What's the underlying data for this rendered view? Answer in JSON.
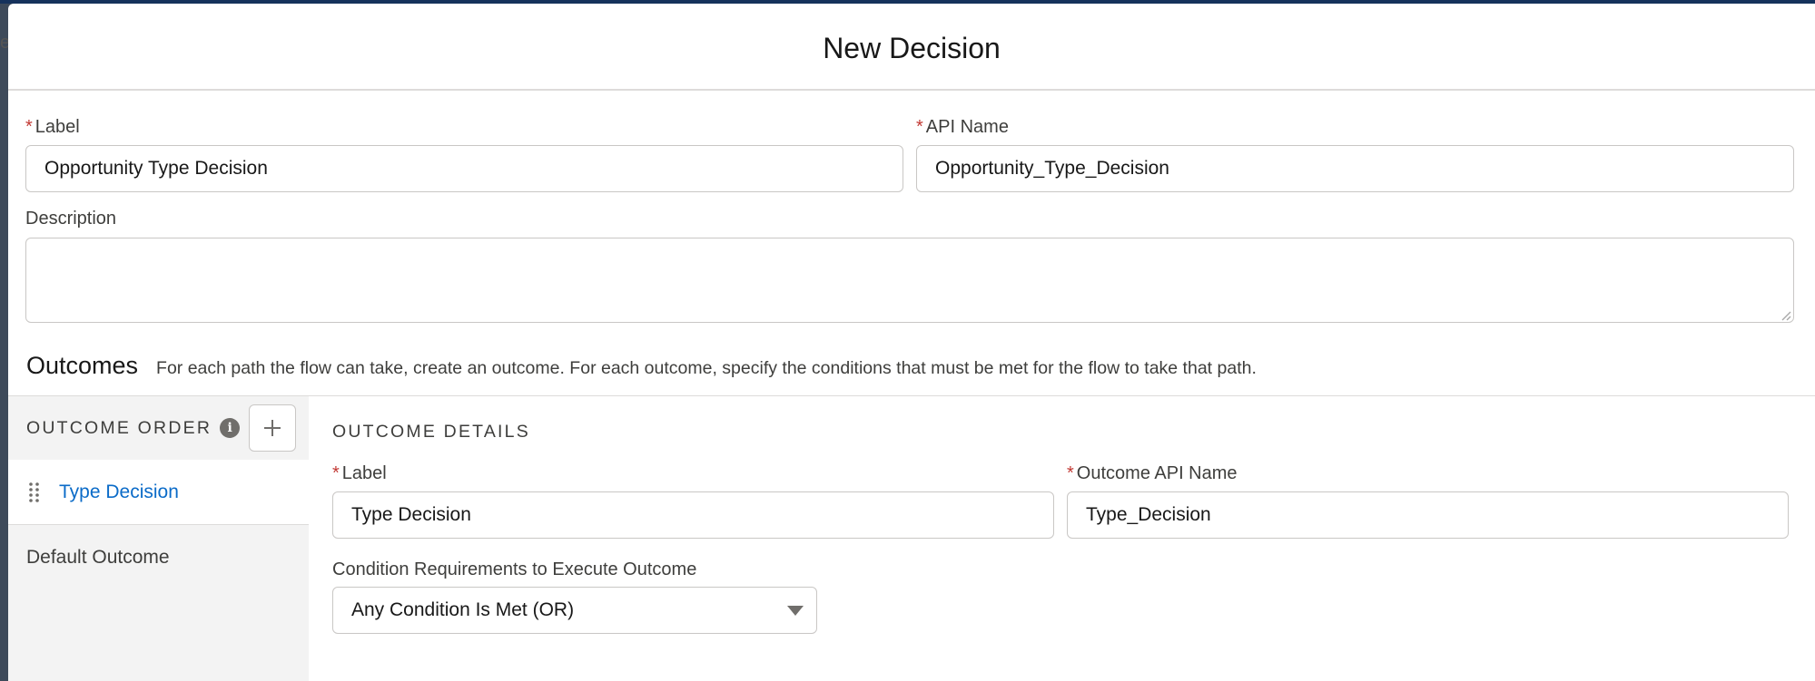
{
  "modal": {
    "title": "New Decision"
  },
  "fields": {
    "label": {
      "label": "Label",
      "value": "Opportunity Type Decision"
    },
    "api_name": {
      "label": "API Name",
      "value": "Opportunity_Type_Decision"
    },
    "description": {
      "label": "Description",
      "value": ""
    }
  },
  "outcomes": {
    "title": "Outcomes",
    "description": "For each path the flow can take, create an outcome. For each outcome, specify the conditions that must be met for the flow to take that path.",
    "order_label": "OUTCOME ORDER",
    "items": [
      {
        "label": "Type Decision",
        "active": true
      },
      {
        "label": "Default Outcome",
        "active": false
      }
    ],
    "details": {
      "title": "OUTCOME DETAILS",
      "label": {
        "label": "Label",
        "value": "Type Decision"
      },
      "api_name": {
        "label": "Outcome API Name",
        "value": "Type_Decision"
      },
      "condition": {
        "label": "Condition Requirements to Execute Outcome",
        "value": "Any Condition Is Met (OR)"
      }
    }
  },
  "required_marker": "*",
  "icons": {
    "info": "info-icon",
    "add": "add-icon",
    "drag": "drag-handle-icon",
    "dropdown": "chevron-down-icon"
  },
  "colors": {
    "link": "#0b6bc8",
    "required": "#c23934",
    "border": "#c9c7c5",
    "sidebar_bg": "#f3f3f3"
  }
}
